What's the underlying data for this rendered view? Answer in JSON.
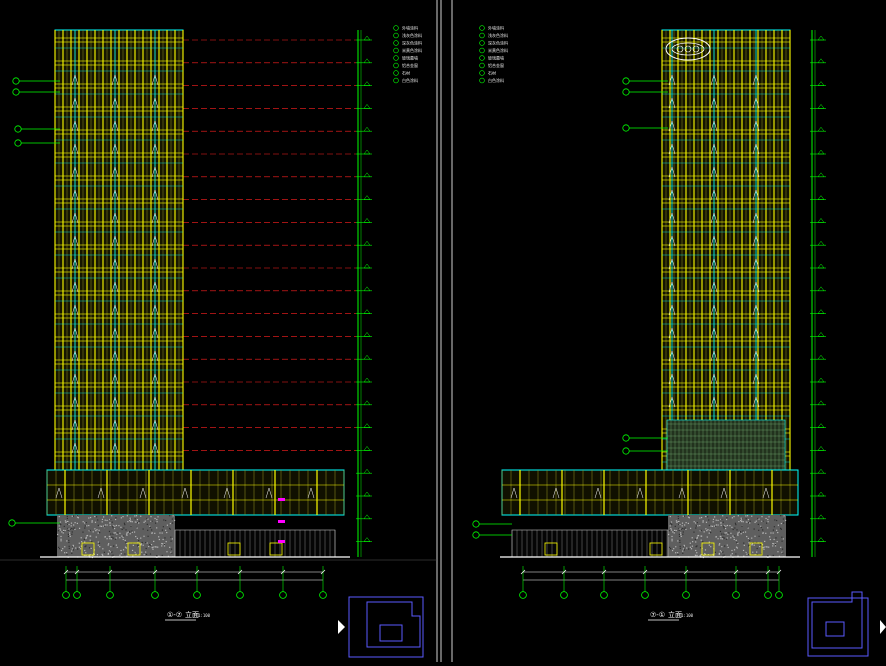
{
  "drawing": {
    "left_sheet": {
      "title_prefix": "①-⑦",
      "title_suffix": "立面",
      "scale": "1:100",
      "legend_items": [
        "外墙涂料",
        "浅灰色涂料",
        "深灰色涂料",
        "米黄色涂料",
        "玻璃幕墙",
        "铝合金窗",
        "石材",
        "白色涂料"
      ]
    },
    "right_sheet": {
      "title_prefix": "⑦-①",
      "title_suffix": "立面",
      "scale": "1:100",
      "legend_items": [
        "外墙涂料",
        "浅灰色涂料",
        "深灰色涂料",
        "米黄色涂料",
        "玻璃幕墙",
        "铝合金窗",
        "石材",
        "白色涂料"
      ]
    }
  },
  "colors": {
    "background": "#000000",
    "yellow": "#ffff00",
    "cyan": "#00ffff",
    "green": "#00ff00",
    "white": "#ffffff",
    "red": "#ff2020",
    "magenta": "#ff00ff",
    "grey": "#8a8a8a",
    "blue": "#5a5aff"
  },
  "icons": [
    "level-marker-icon",
    "callout-circle-icon",
    "play-arrow-icon",
    "key-plan-icon",
    "logo-badge-icon"
  ]
}
